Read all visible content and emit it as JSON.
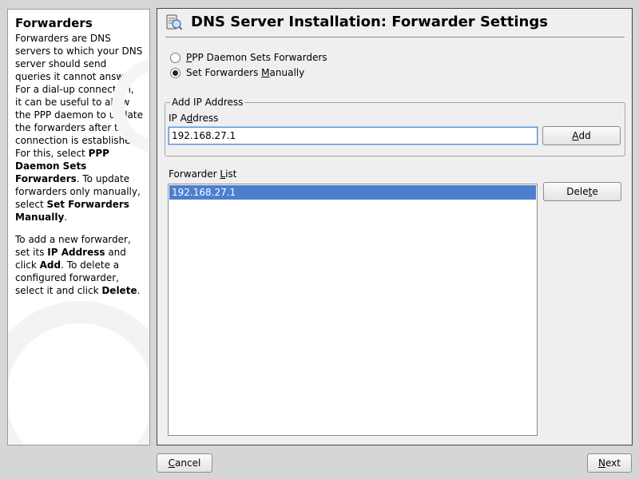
{
  "help": {
    "title": "Forwarders",
    "p1": [
      {
        "t": "Forwarders are DNS servers to which your DNS server should send queries it cannot answer. For a dial-up connection, it can be useful to allow the PPP daemon to update the forwarders after the connection is established. For this, select "
      },
      {
        "t": "PPP Daemon Sets Forwarders",
        "b": true
      },
      {
        "t": ". To update forwarders only manually, select "
      },
      {
        "t": "Set Forwarders Manually",
        "b": true
      },
      {
        "t": "."
      }
    ],
    "p2": [
      {
        "t": "To add a new forwarder, set its "
      },
      {
        "t": "IP Address",
        "b": true
      },
      {
        "t": " and click "
      },
      {
        "t": "Add",
        "b": true
      },
      {
        "t": ". To delete a configured forwarder, select it and click "
      },
      {
        "t": "Delete",
        "b": true
      },
      {
        "t": "."
      }
    ]
  },
  "main": {
    "title": "DNS Server Installation: Forwarder Settings",
    "icon": "dns-server-icon",
    "radio_ppp": {
      "pre": "",
      "u": "P",
      "post": "PP Daemon Sets Forwarders",
      "checked": false
    },
    "radio_manual": {
      "pre": "Set Forwarders ",
      "u": "M",
      "post": "anually",
      "checked": true
    },
    "add_group": {
      "legend": "Add IP Address",
      "field_label": {
        "pre": "IP A",
        "u": "d",
        "post": "dress"
      },
      "ip_value": "192.168.27.1",
      "add_button": {
        "pre": "",
        "u": "A",
        "post": "dd"
      }
    },
    "forwarder_list": {
      "label": {
        "pre": "Forwarder ",
        "u": "L",
        "post": "ist"
      },
      "items": [
        "192.168.27.1"
      ],
      "selected_index": 0
    },
    "delete_button": {
      "pre": "Dele",
      "u": "t",
      "post": "e"
    }
  },
  "footer": {
    "cancel": {
      "pre": "",
      "u": "C",
      "post": "ancel"
    },
    "next": {
      "pre": "",
      "u": "N",
      "post": "ext"
    }
  },
  "colors": {
    "selection": "#4b7fcf",
    "focus_border": "#5b8fd0"
  }
}
